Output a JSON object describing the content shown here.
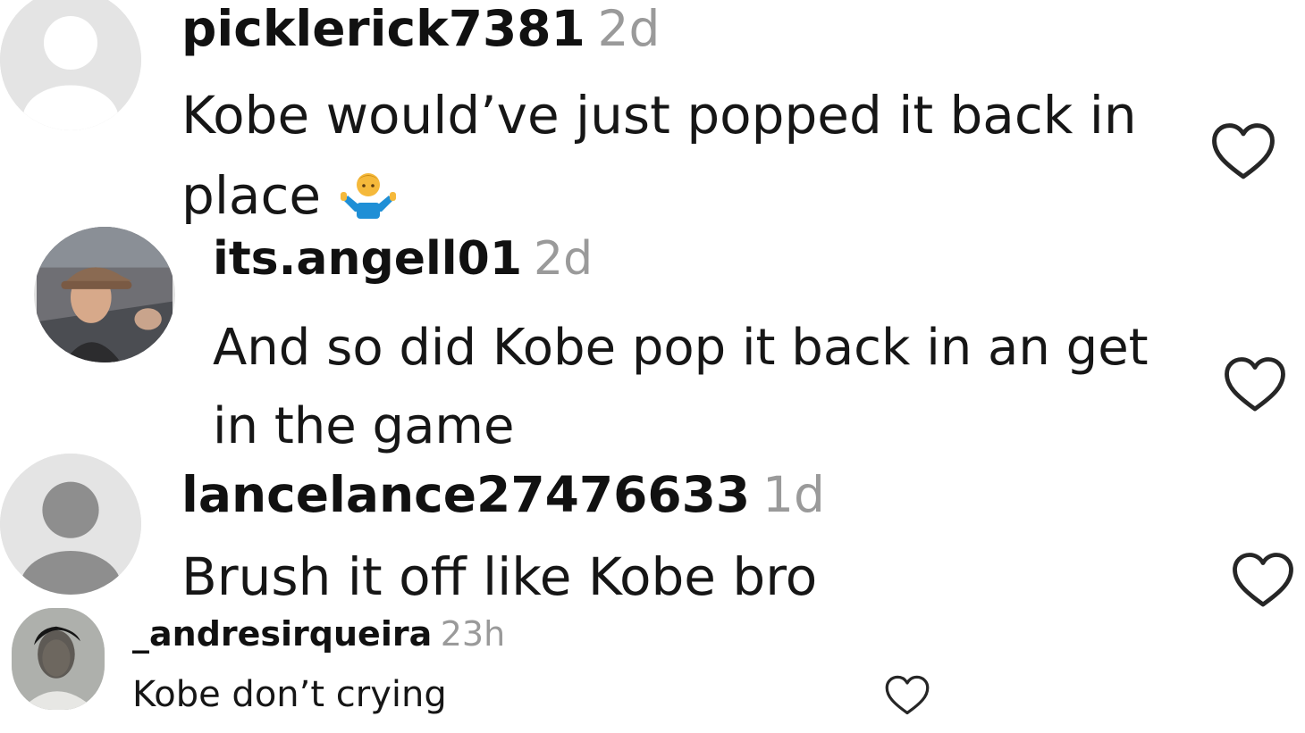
{
  "comments": [
    {
      "username": "picklerick7381",
      "time": "2d",
      "text": "Kobe would’ve just popped it back in place",
      "avatar": "default-avatar",
      "emoji": "person-shrugging-emoji"
    },
    {
      "username": "its.angell01",
      "time": "2d",
      "text": "And so did Kobe pop it back in an get in the game",
      "avatar": "photo-avatar-man-in-car"
    },
    {
      "username": "lancelance27476633",
      "time": "1d",
      "text": "Brush it off like Kobe bro",
      "avatar": "default-avatar"
    },
    {
      "username": "_andresirqueira",
      "time": "23h",
      "text": "Kobe don’t crying",
      "avatar": "photo-avatar-dark"
    }
  ],
  "icons": {
    "like": "heart-outline-icon",
    "like_color": "#262626"
  },
  "colors": {
    "username": "#111111",
    "timestamp": "#9a9a9a",
    "avatar_bg": "#e2e2e2",
    "avatar_fg": "#8e8e8e"
  }
}
